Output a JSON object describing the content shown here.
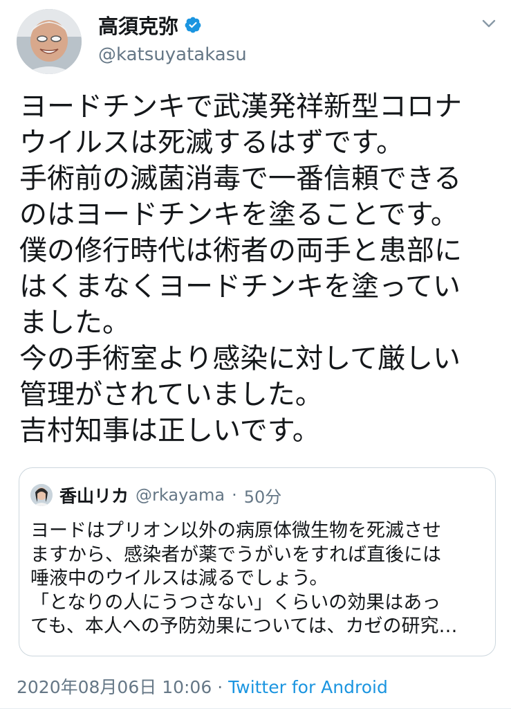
{
  "tweet": {
    "author": {
      "display_name": "高須克弥",
      "handle": "@katsuyatakasu",
      "verified": true
    },
    "body_lines": [
      "ヨードチンキで武漢発祥新型コロナ",
      "ウイルスは死滅するはずです。",
      "手術前の滅菌消毒で一番信頼できる",
      "のはヨードチンキを塗ることです。",
      "僕の修行時代は術者の両手と患部に",
      "はくまなくヨードチンキを塗ってい",
      "ました。",
      "今の手術室より感染に対して厳しい",
      "管理がされていました。",
      "吉村知事は正しいです。"
    ],
    "quoted": {
      "display_name": "香山リカ",
      "handle": "@rkayama",
      "separator": "·",
      "time": "50分",
      "body_lines": [
        "ヨードはプリオン以外の病原体微生物を死滅させ",
        "ますから、感染者が薬でうがいをすれば直後には",
        "唾液中のウイルスは減るでしょう。",
        "「となりの人にうつさない」くらいの効果はあっ",
        "ても、本人への予防効果については、カゼの研究…"
      ]
    },
    "footer": {
      "timestamp": "2020年08月06日 10:06",
      "separator": "·",
      "source": "Twitter for Android"
    }
  },
  "colors": {
    "text": "#14171a",
    "secondary": "#657786",
    "accent": "#1b95e0",
    "border": "#ccd6dd"
  },
  "icons": {
    "verified": "verified-badge-icon",
    "menu": "chevron-down-icon"
  }
}
